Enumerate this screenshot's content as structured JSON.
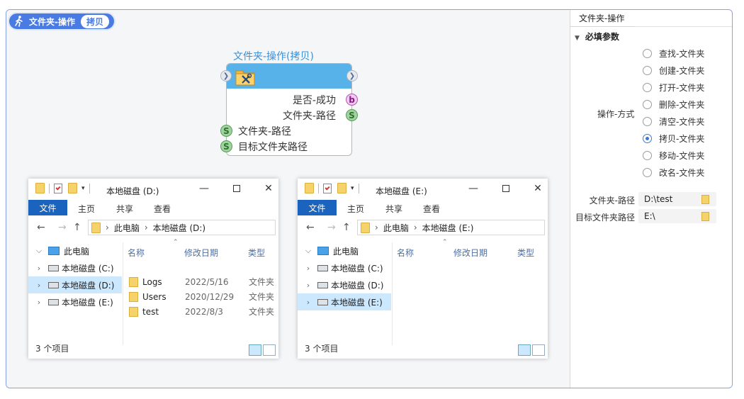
{
  "badge": {
    "title": "文件夹-操作",
    "pill": "拷贝"
  },
  "node": {
    "title": "文件夹-操作(拷贝)",
    "outputs": [
      {
        "label": "是否-成功",
        "type": "b"
      },
      {
        "label": "文件夹-路径",
        "type": "S"
      }
    ],
    "inputs": [
      {
        "label": "文件夹-路径",
        "type": "S"
      },
      {
        "label": "目标文件夹路径",
        "type": "S"
      }
    ]
  },
  "explorer_d": {
    "title": "本地磁盘 (D:)",
    "ribbon": {
      "file": "文件",
      "home": "主页",
      "share": "共享",
      "view": "查看"
    },
    "address": [
      "此电脑",
      "本地磁盘 (D:)"
    ],
    "tree": [
      {
        "label": "此电脑",
        "kind": "pc"
      },
      {
        "label": "本地磁盘 (C:)",
        "kind": "drive"
      },
      {
        "label": "本地磁盘 (D:)",
        "kind": "drive",
        "selected": true
      },
      {
        "label": "本地磁盘 (E:)",
        "kind": "drive"
      }
    ],
    "columns": {
      "name": "名称",
      "date": "修改日期",
      "type": "类型"
    },
    "files": [
      {
        "name": "Logs",
        "date": "2022/5/16",
        "type": "文件夹"
      },
      {
        "name": "Users",
        "date": "2020/12/29",
        "type": "文件夹"
      },
      {
        "name": "test",
        "date": "2022/8/3",
        "type": "文件夹"
      }
    ],
    "status": "3 个项目"
  },
  "explorer_e": {
    "title": "本地磁盘 (E:)",
    "ribbon": {
      "file": "文件",
      "home": "主页",
      "share": "共享",
      "view": "查看"
    },
    "address": [
      "此电脑",
      "本地磁盘 (E:)"
    ],
    "tree": [
      {
        "label": "此电脑",
        "kind": "pc"
      },
      {
        "label": "本地磁盘 (C:)",
        "kind": "drive"
      },
      {
        "label": "本地磁盘 (D:)",
        "kind": "drive"
      },
      {
        "label": "本地磁盘 (E:)",
        "kind": "drive",
        "selected": true
      }
    ],
    "columns": {
      "name": "名称",
      "date": "修改日期",
      "type": "类型"
    },
    "files": [],
    "status": "3 个项目"
  },
  "panel": {
    "tab": "文件夹-操作",
    "section": "必填参数",
    "op_label": "操作-方式",
    "options": [
      "查找-文件夹",
      "创建-文件夹",
      "打开-文件夹",
      "删除-文件夹",
      "清空-文件夹",
      "拷贝-文件夹",
      "移动-文件夹",
      "改名-文件夹"
    ],
    "selected_option": "拷贝-文件夹",
    "fields": [
      {
        "label": "文件夹-路径",
        "value": "D:\\test"
      },
      {
        "label": "目标文件夹路径",
        "value": "E:\\"
      }
    ]
  },
  "colors": {
    "accent": "#4a7be3",
    "node_header": "#58b2ea",
    "ribbon_file": "#1a64c0"
  }
}
